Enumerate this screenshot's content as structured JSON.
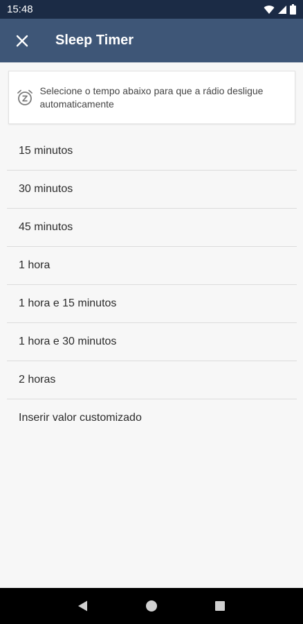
{
  "status_bar": {
    "time": "15:48"
  },
  "header": {
    "title": "Sleep Timer",
    "close_icon": "close-icon"
  },
  "info_card": {
    "icon": "alarm-snooze-icon",
    "text": "Selecione o tempo abaixo para que a rádio desligue automaticamente"
  },
  "options": [
    {
      "label": "15 minutos"
    },
    {
      "label": "30 minutos"
    },
    {
      "label": "45 minutos"
    },
    {
      "label": "1 hora"
    },
    {
      "label": "1 hora e 15 minutos"
    },
    {
      "label": "1 hora e 30 minutos"
    },
    {
      "label": "2 horas"
    },
    {
      "label": "Inserir valor customizado"
    }
  ],
  "navigation": {
    "back_icon": "back-triangle-icon",
    "home_icon": "home-circle-icon",
    "recents_icon": "recents-square-icon"
  },
  "colors": {
    "status_bar": "#1b2b45",
    "app_bar": "#3e5677",
    "background": "#f7f7f7"
  }
}
